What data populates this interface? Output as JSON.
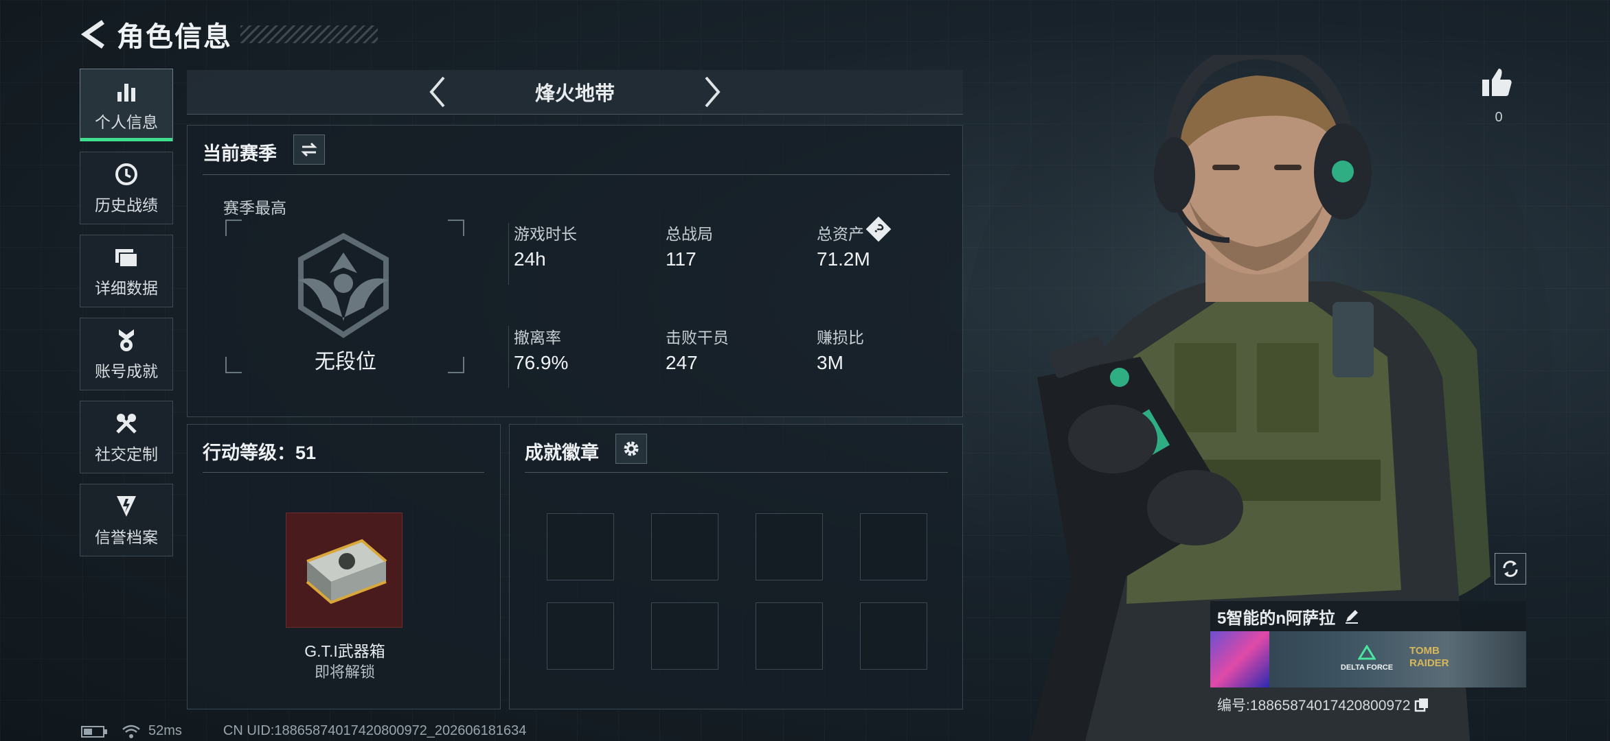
{
  "header": {
    "title": "角色信息"
  },
  "sidebar": {
    "items": [
      {
        "label": "个人信息",
        "active": true
      },
      {
        "label": "历史战绩"
      },
      {
        "label": "详细数据"
      },
      {
        "label": "账号成就"
      },
      {
        "label": "社交定制"
      },
      {
        "label": "信誉档案"
      }
    ]
  },
  "mode": {
    "name": "烽火地带"
  },
  "season": {
    "title": "当前赛季",
    "best_label": "赛季最高",
    "rank": "无段位",
    "stats": [
      {
        "label": "游戏时长",
        "value": "24h"
      },
      {
        "label": "总战局",
        "value": "117"
      },
      {
        "label": "总资产",
        "value": "71.2M"
      },
      {
        "label": "撤离率",
        "value": "76.9%"
      },
      {
        "label": "击败干员",
        "value": "247"
      },
      {
        "label": "赚损比",
        "value": "3M"
      }
    ],
    "help_icon_text": "?"
  },
  "level": {
    "title": "行动等级：51",
    "reward_name": "G.T.I武器箱",
    "reward_status": "即将解锁"
  },
  "badges": {
    "title": "成就徽章",
    "slot_count": 8
  },
  "profile": {
    "likes": "0",
    "player_name": "5智能的n阿萨拉",
    "banner_text_1": "DELTA FORCE",
    "banner_text_2": "TOMB RAIDER",
    "id_label": "编号:1886587401742080097​2"
  },
  "status": {
    "ping": "52ms",
    "uid": "CN UID:18865874017420800972_202606181634"
  },
  "colors": {
    "accent_green": "#3ee08e",
    "crate_bg": "#4a1b1d"
  }
}
